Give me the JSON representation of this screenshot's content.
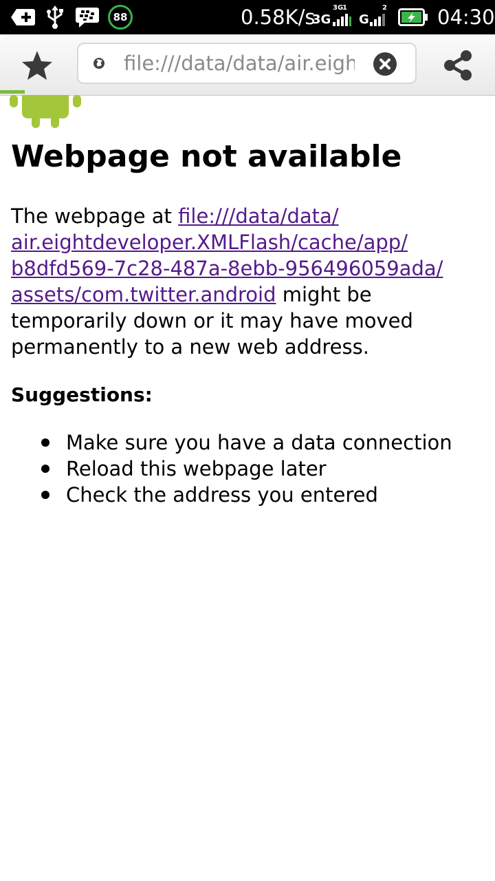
{
  "status_bar": {
    "notification_count": "88",
    "net_speed": "0.58K/s",
    "network1_label": "3G",
    "network1_super": "3G",
    "network1_sub": "1",
    "network2_label": "G",
    "network2_sub": "2",
    "time": "04:30",
    "icons": [
      "add-box-icon",
      "usb-icon",
      "bbm-chat-icon",
      "battery-charging-icon"
    ]
  },
  "toolbar": {
    "url": "file:///data/data/air.eightdeveloper.XMLFlash/cache/app/b8dfd569-7c28-487a-8ebb-956496059ada/assets/com.twitter.android",
    "icons": [
      "star-icon",
      "globe-icon",
      "clear-icon",
      "share-icon"
    ],
    "progress_color": "#7cbb3c"
  },
  "page": {
    "title": "Webpage not available",
    "body_prefix": "The webpage at ",
    "link_lines": [
      "file:///data/data/",
      "air.eightdeveloper.XMLFlash/cache/app/",
      "b8dfd569-7c28-487a-8ebb-956496059ada/",
      "assets/com.twitter.android"
    ],
    "body_suffix": " might be temporarily down or it may have moved permanently to a new web address.",
    "link_color": "#551a8b",
    "suggestions_title": "Suggestions:",
    "suggestions": [
      "Make sure you have a data connection",
      "Reload this webpage later",
      "Check the address you entered"
    ]
  }
}
